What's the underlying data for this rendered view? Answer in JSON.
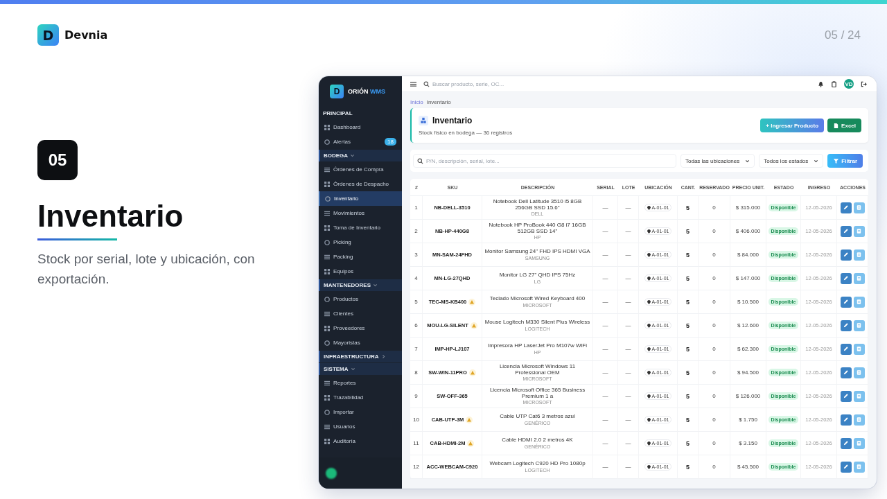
{
  "slide": {
    "logo": {
      "mark": "D",
      "name": "Devnia"
    },
    "page_number": "05 / 24",
    "number": "05",
    "title": "Inventario",
    "subtitle": "Stock por serial, lote y ubicación, con exportación."
  },
  "app": {
    "brand": {
      "mark": "D",
      "name": "ORIÓN",
      "accent": "WMS"
    },
    "sidebar": {
      "sections": [
        {
          "label": "PRINCIPAL",
          "kind": "heading",
          "items": [
            {
              "label": "Dashboard",
              "selected": false
            },
            {
              "label": "Alertas",
              "selected": false,
              "badge": "18"
            }
          ]
        },
        {
          "label": "BODEGA",
          "kind": "group",
          "expanded": true,
          "items": [
            {
              "label": "Órdenes de Compra",
              "selected": false
            },
            {
              "label": "Órdenes de Despacho",
              "selected": false
            },
            {
              "label": "Inventario",
              "selected": true
            },
            {
              "label": "Movimientos",
              "selected": false
            },
            {
              "label": "Toma de Inventario",
              "selected": false
            },
            {
              "label": "Picking",
              "selected": false
            },
            {
              "label": "Packing",
              "selected": false
            },
            {
              "label": "Equipos",
              "selected": false
            }
          ]
        },
        {
          "label": "MANTENEDORES",
          "kind": "group",
          "expanded": true,
          "items": [
            {
              "label": "Productos",
              "selected": false
            },
            {
              "label": "Clientes",
              "selected": false
            },
            {
              "label": "Proveedores",
              "selected": false
            },
            {
              "label": "Mayoristas",
              "selected": false
            }
          ]
        },
        {
          "label": "INFRAESTRUCTURA",
          "kind": "group",
          "expanded": false
        },
        {
          "label": "SISTEMA",
          "kind": "group",
          "expanded": true,
          "items": [
            {
              "label": "Reportes",
              "selected": false
            },
            {
              "label": "Trazabilidad",
              "selected": false
            },
            {
              "label": "Importar",
              "selected": false
            },
            {
              "label": "Usuarios",
              "selected": false
            },
            {
              "label": "Auditoría",
              "selected": false
            }
          ]
        }
      ]
    },
    "topbar": {
      "search": {
        "placeholder": "Buscar producto, serie, OC..."
      },
      "avatar": "VD"
    },
    "breadcrumb": [
      "Inicio",
      "Inventario"
    ],
    "header": {
      "title": "Inventario",
      "subtitle": "Stock físico en bodega — 36 registros",
      "buttons": [
        {
          "label": "+ Ingresar Producto",
          "kind": "primary"
        },
        {
          "label": "Excel",
          "kind": "export"
        }
      ]
    },
    "filters": {
      "search": {
        "placeholder": "P/N, descripción, serial, lote..."
      },
      "selects": [
        "Todas las ubicaciones",
        "Todos los estados"
      ],
      "button": "Filtrar"
    },
    "table": {
      "columns": [
        "#",
        "SKU",
        "DESCRIPCIÓN",
        "SERIAL",
        "LOTE",
        "UBICACIÓN",
        "CANT.",
        "RESERVADO",
        "PRECIO UNIT.",
        "ESTADO",
        "INGRESO",
        "ACCIONES"
      ],
      "rows": [
        {
          "n": "1",
          "sku": "NB-DELL-3510",
          "warning": false,
          "description": "Notebook Dell Latitude 3510 i5 8GB 256GB SSD 15.6\"",
          "brand": "DELL",
          "serial": "—",
          "lote": "—",
          "location": "A-01-01",
          "qty": "5",
          "reserved": "0",
          "price": "$ 315.000",
          "status": "Disponible",
          "date": "12-05-2026"
        },
        {
          "n": "2",
          "sku": "NB-HP-440G8",
          "warning": false,
          "description": "Notebook HP ProBook 440 G8 i7 16GB 512GB SSD 14\"",
          "brand": "HP",
          "serial": "—",
          "lote": "—",
          "location": "A-01-01",
          "qty": "5",
          "reserved": "0",
          "price": "$ 406.000",
          "status": "Disponible",
          "date": "12-05-2026"
        },
        {
          "n": "3",
          "sku": "MN-SAM-24FHD",
          "warning": false,
          "description": "Monitor Samsung 24\" FHD IPS HDMI VGA",
          "brand": "SAMSUNG",
          "serial": "—",
          "lote": "—",
          "location": "A-01-01",
          "qty": "5",
          "reserved": "0",
          "price": "$ 84.000",
          "status": "Disponible",
          "date": "12-05-2026"
        },
        {
          "n": "4",
          "sku": "MN-LG-27QHD",
          "warning": false,
          "description": "Monitor LG 27\" QHD IPS 75Hz",
          "brand": "LG",
          "serial": "—",
          "lote": "—",
          "location": "A-01-01",
          "qty": "5",
          "reserved": "0",
          "price": "$ 147.000",
          "status": "Disponible",
          "date": "12-05-2026"
        },
        {
          "n": "5",
          "sku": "TEC-MS-KB400",
          "warning": true,
          "description": "Teclado Microsoft Wired Keyboard 400",
          "brand": "MICROSOFT",
          "serial": "—",
          "lote": "—",
          "location": "A-01-01",
          "qty": "5",
          "reserved": "0",
          "price": "$ 10.500",
          "status": "Disponible",
          "date": "12-05-2026"
        },
        {
          "n": "6",
          "sku": "MOU-LG-SILENT",
          "warning": true,
          "description": "Mouse Logitech M330 Silent Plus Wireless",
          "brand": "LOGITECH",
          "serial": "—",
          "lote": "—",
          "location": "A-01-01",
          "qty": "5",
          "reserved": "0",
          "price": "$ 12.600",
          "status": "Disponible",
          "date": "12-05-2026"
        },
        {
          "n": "7",
          "sku": "IMP-HP-LJ107",
          "warning": false,
          "description": "Impresora HP LaserJet Pro M107w WiFi",
          "brand": "HP",
          "serial": "—",
          "lote": "—",
          "location": "A-01-01",
          "qty": "5",
          "reserved": "0",
          "price": "$ 62.300",
          "status": "Disponible",
          "date": "12-05-2026"
        },
        {
          "n": "8",
          "sku": "SW-WIN-11PRO",
          "warning": true,
          "description": "Licencia Microsoft Windows 11 Professional OEM",
          "brand": "MICROSOFT",
          "serial": "—",
          "lote": "—",
          "location": "A-01-01",
          "qty": "5",
          "reserved": "0",
          "price": "$ 94.500",
          "status": "Disponible",
          "date": "12-05-2026"
        },
        {
          "n": "9",
          "sku": "SW-OFF-365",
          "warning": false,
          "description": "Licencia Microsoft Office 365 Business Premium 1 a",
          "brand": "MICROSOFT",
          "serial": "—",
          "lote": "—",
          "location": "A-01-01",
          "qty": "5",
          "reserved": "0",
          "price": "$ 126.000",
          "status": "Disponible",
          "date": "12-05-2026"
        },
        {
          "n": "10",
          "sku": "CAB-UTP-3M",
          "warning": true,
          "description": "Cable UTP Cat6 3 metros azul",
          "brand": "GENÉRICO",
          "serial": "—",
          "lote": "—",
          "location": "A-01-01",
          "qty": "5",
          "reserved": "0",
          "price": "$ 1.750",
          "status": "Disponible",
          "date": "12-05-2026"
        },
        {
          "n": "11",
          "sku": "CAB-HDMI-2M",
          "warning": true,
          "description": "Cable HDMI 2.0 2 metros 4K",
          "brand": "GENÉRICO",
          "serial": "—",
          "lote": "—",
          "location": "A-01-01",
          "qty": "5",
          "reserved": "0",
          "price": "$ 3.150",
          "status": "Disponible",
          "date": "12-05-2026"
        },
        {
          "n": "12",
          "sku": "ACC-WEBCAM-C920",
          "warning": false,
          "description": "Webcam Logitech C920 HD Pro 1080p",
          "brand": "LOGITECH",
          "serial": "—",
          "lote": "—",
          "location": "A-01-01",
          "qty": "5",
          "reserved": "0",
          "price": "$ 45.500",
          "status": "Disponible",
          "date": "12-05-2026"
        }
      ]
    }
  }
}
